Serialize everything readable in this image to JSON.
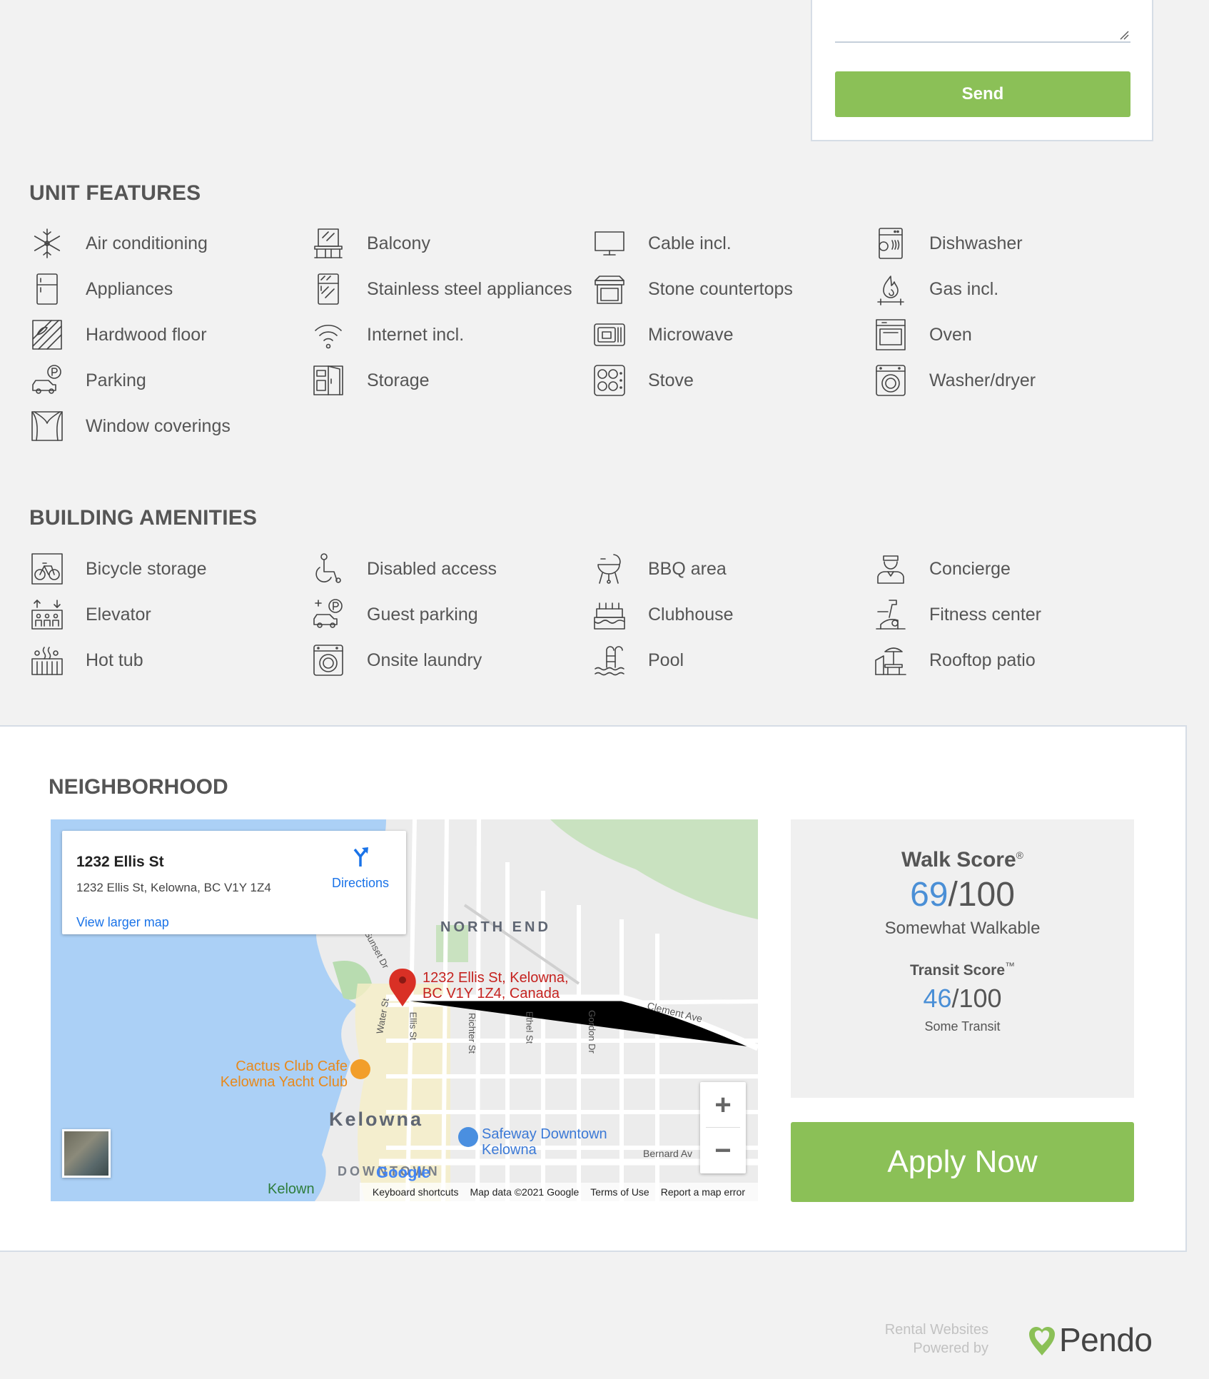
{
  "form": {
    "send_label": "Send"
  },
  "unit_features": {
    "title": "UNIT FEATURES",
    "items": [
      {
        "label": "Air conditioning",
        "icon": "snowflake-icon"
      },
      {
        "label": "Balcony",
        "icon": "balcony-icon"
      },
      {
        "label": "Cable incl.",
        "icon": "tv-icon"
      },
      {
        "label": "Dishwasher",
        "icon": "dishwasher-icon"
      },
      {
        "label": "Appliances",
        "icon": "fridge-icon"
      },
      {
        "label": "Stainless steel appliances",
        "icon": "steel-fridge-icon"
      },
      {
        "label": "Stone countertops",
        "icon": "countertop-icon"
      },
      {
        "label": "Gas incl.",
        "icon": "gas-flame-icon"
      },
      {
        "label": "Hardwood floor",
        "icon": "hardwood-floor-icon"
      },
      {
        "label": "Internet incl.",
        "icon": "wifi-icon"
      },
      {
        "label": "Microwave",
        "icon": "microwave-icon"
      },
      {
        "label": "Oven",
        "icon": "oven-icon"
      },
      {
        "label": "Parking",
        "icon": "parking-car-icon"
      },
      {
        "label": "Storage",
        "icon": "storage-cabinet-icon"
      },
      {
        "label": "Stove",
        "icon": "stove-icon"
      },
      {
        "label": "Washer/dryer",
        "icon": "washer-icon"
      },
      {
        "label": "Window coverings",
        "icon": "curtains-icon"
      }
    ]
  },
  "building_amenities": {
    "title": "BUILDING AMENITIES",
    "items": [
      {
        "label": "Bicycle storage",
        "icon": "bicycle-icon"
      },
      {
        "label": "Disabled access",
        "icon": "wheelchair-icon"
      },
      {
        "label": "BBQ area",
        "icon": "bbq-icon"
      },
      {
        "label": "Concierge",
        "icon": "concierge-icon"
      },
      {
        "label": "Elevator",
        "icon": "elevator-icon"
      },
      {
        "label": "Guest parking",
        "icon": "guest-parking-icon"
      },
      {
        "label": "Clubhouse",
        "icon": "clubhouse-cake-icon"
      },
      {
        "label": "Fitness center",
        "icon": "exercise-bike-icon"
      },
      {
        "label": "Hot tub",
        "icon": "hot-tub-icon"
      },
      {
        "label": "Onsite laundry",
        "icon": "laundry-icon"
      },
      {
        "label": "Pool",
        "icon": "pool-ladder-icon"
      },
      {
        "label": "Rooftop patio",
        "icon": "rooftop-patio-icon"
      }
    ]
  },
  "neighborhood": {
    "title": "NEIGHBORHOOD",
    "map": {
      "card_title": "1232 Ellis St",
      "card_address": "1232 Ellis St, Kelowna, BC V1Y 1Z4",
      "directions_label": "Directions",
      "larger_map_label": "View larger map",
      "pin_label_line1": "1232 Ellis St, Kelowna,",
      "pin_label_line2": "BC V1Y 1Z4, Canada",
      "area_north_end": "NORTH END",
      "area_kelowna": "Kelowna",
      "area_downtown": "DOWNTOWN",
      "poi_cactus_line1": "Cactus Club Cafe",
      "poi_cactus_line2": "Kelowna Yacht Club",
      "poi_safeway_line1": "Safeway Downtown",
      "poi_safeway_line2": "Kelowna",
      "street_sunset": "Sunset Dr",
      "street_water": "Water St",
      "street_ellis": "Ellis St",
      "street_richter": "Richter St",
      "street_ethel": "Ethel St",
      "street_gordon": "Gordon Dr",
      "street_clement": "Clement Ave",
      "street_bernard": "Bernard Av",
      "city_partial": "Kelown",
      "google_logo": "Google",
      "footer": [
        "Keyboard shortcuts",
        "Map data ©2021 Google",
        "Terms of Use",
        "Report a map error"
      ],
      "zoom_in": "+",
      "zoom_out": "−"
    },
    "walk_score": {
      "title": "Walk Score",
      "mark": "®",
      "score": "69",
      "max": "/100",
      "description": "Somewhat Walkable"
    },
    "transit_score": {
      "title": "Transit Score",
      "mark": "™",
      "score": "46",
      "max": "/100",
      "description": "Some Transit"
    },
    "apply_label": "Apply Now"
  },
  "footer": {
    "powered_line1": "Rental Websites",
    "powered_line2": "Powered by",
    "brand": "Pendo"
  },
  "colors": {
    "accent_green": "#8bc057",
    "score_blue": "#4a8fd6",
    "link_blue": "#1a73e8",
    "pin_red": "#d93025"
  }
}
